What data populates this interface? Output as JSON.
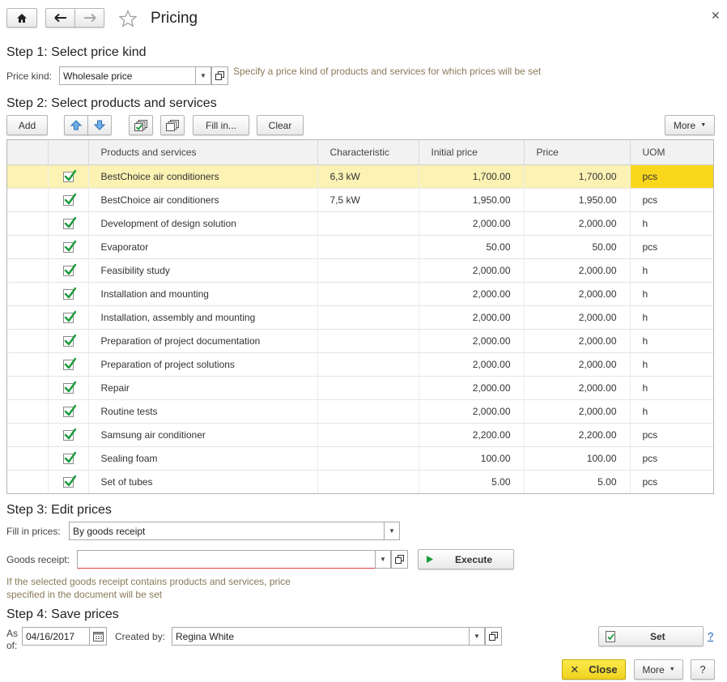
{
  "header": {
    "title": "Pricing"
  },
  "step1": {
    "heading": "Step 1: Select price kind",
    "label": "Price kind:",
    "value": "Wholesale price",
    "hint": "Specify a price kind of products and services for which prices will be set"
  },
  "step2": {
    "heading": "Step 2: Select products and services",
    "toolbar": {
      "add": "Add",
      "fill_in": "Fill in...",
      "clear": "Clear",
      "more": "More"
    },
    "columns": [
      "Products and services",
      "Characteristic",
      "Initial price",
      "Price",
      "UOM"
    ],
    "rows": [
      {
        "product": "BestChoice air conditioners",
        "characteristic": "6,3 kW",
        "initial_price": "1,700.00",
        "price": "1,700.00",
        "uom": "pcs",
        "checked": true
      },
      {
        "product": "BestChoice air conditioners",
        "characteristic": "7,5 kW",
        "initial_price": "1,950.00",
        "price": "1,950.00",
        "uom": "pcs",
        "checked": true
      },
      {
        "product": "Development of design solution",
        "characteristic": "",
        "initial_price": "2,000.00",
        "price": "2,000.00",
        "uom": "h",
        "checked": true
      },
      {
        "product": "Evaporator",
        "characteristic": "",
        "initial_price": "50.00",
        "price": "50.00",
        "uom": "pcs",
        "checked": true
      },
      {
        "product": "Feasibility study",
        "characteristic": "",
        "initial_price": "2,000.00",
        "price": "2,000.00",
        "uom": "h",
        "checked": true
      },
      {
        "product": "Installation and mounting",
        "characteristic": "",
        "initial_price": "2,000.00",
        "price": "2,000.00",
        "uom": "h",
        "checked": true
      },
      {
        "product": "Installation, assembly and mounting",
        "characteristic": "",
        "initial_price": "2,000.00",
        "price": "2,000.00",
        "uom": "h",
        "checked": true
      },
      {
        "product": "Preparation of project documentation",
        "characteristic": "",
        "initial_price": "2,000.00",
        "price": "2,000.00",
        "uom": "h",
        "checked": true
      },
      {
        "product": "Preparation of project solutions",
        "characteristic": "",
        "initial_price": "2,000.00",
        "price": "2,000.00",
        "uom": "h",
        "checked": true
      },
      {
        "product": "Repair",
        "characteristic": "",
        "initial_price": "2,000.00",
        "price": "2,000.00",
        "uom": "h",
        "checked": true
      },
      {
        "product": "Routine tests",
        "characteristic": "",
        "initial_price": "2,000.00",
        "price": "2,000.00",
        "uom": "h",
        "checked": true
      },
      {
        "product": "Samsung air conditioner",
        "characteristic": "",
        "initial_price": "2,200.00",
        "price": "2,200.00",
        "uom": "pcs",
        "checked": true
      },
      {
        "product": "Sealing foam",
        "characteristic": "",
        "initial_price": "100.00",
        "price": "100.00",
        "uom": "pcs",
        "checked": true
      },
      {
        "product": "Set of tubes",
        "characteristic": "",
        "initial_price": "5.00",
        "price": "5.00",
        "uom": "pcs",
        "checked": true
      }
    ]
  },
  "step3": {
    "heading": "Step 3: Edit prices",
    "fill_label": "Fill in prices:",
    "fill_value": "By goods receipt",
    "receipt_label": "Goods receipt:",
    "receipt_value": "",
    "execute": "Execute",
    "hint": "If the selected goods receipt contains products and services, price specified in the document will be set"
  },
  "step4": {
    "heading": "Step 4: Save prices",
    "as_of_label": "As of:",
    "date": "04/16/2017",
    "created_by_label": "Created by:",
    "created_by": "Regina White",
    "set": "Set",
    "help": "?"
  },
  "footer": {
    "close": "Close",
    "more": "More",
    "help": "?"
  },
  "colors": {
    "selected_row": "#fbf2b3",
    "selected_cell": "#f9d71c",
    "close_button": "#f5df2e",
    "check": "#1a9a3a"
  }
}
